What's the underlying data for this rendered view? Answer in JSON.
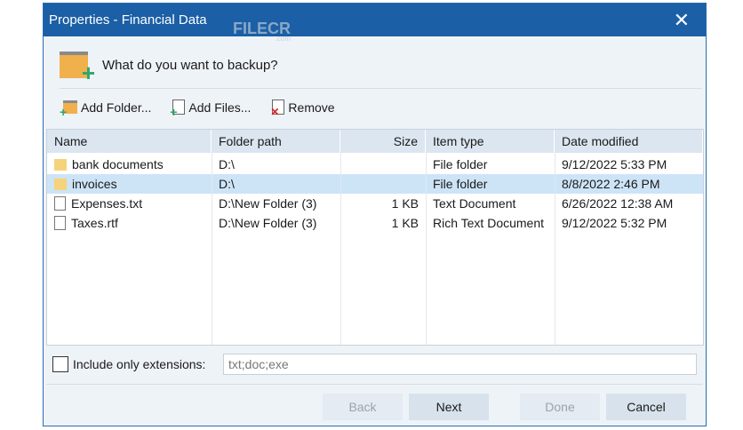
{
  "window": {
    "title": "Properties - Financial Data",
    "close": "✕"
  },
  "watermark": {
    "text": "FILECR",
    "sub": ".com"
  },
  "heading": "What do you want to backup?",
  "toolbar": {
    "add_folder": "Add Folder...",
    "add_files": "Add Files...",
    "remove": "Remove"
  },
  "columns": [
    "Name",
    "Folder path",
    "Size",
    "Item type",
    "Date modified"
  ],
  "rows": [
    {
      "name": "bank documents",
      "path": "D:\\",
      "size": "",
      "type": "File folder",
      "date": "9/12/2022 5:33 PM"
    },
    {
      "name": "invoices",
      "path": "D:\\",
      "size": "",
      "type": "File folder",
      "date": "8/8/2022 2:46 PM"
    },
    {
      "name": "Expenses.txt",
      "path": "D:\\New Folder (3)",
      "size": "1 KB",
      "type": "Text Document",
      "date": "6/26/2022 12:38 AM"
    },
    {
      "name": "Taxes.rtf",
      "path": "D:\\New Folder (3)",
      "size": "1 KB",
      "type": "Rich Text Document",
      "date": "9/12/2022 5:32 PM"
    }
  ],
  "extensions": {
    "label": "Include only extensions:",
    "value": "txt;doc;exe",
    "checked": false
  },
  "buttons": {
    "back": "Back",
    "next": "Next",
    "done": "Done",
    "cancel": "Cancel"
  }
}
